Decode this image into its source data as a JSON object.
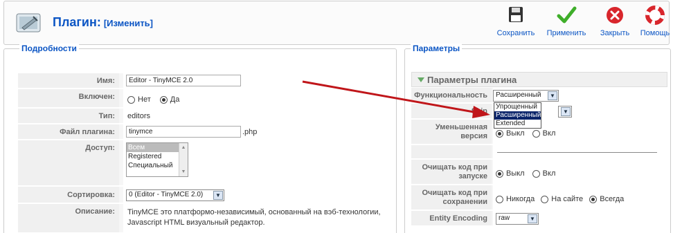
{
  "toolbar": {
    "title": "Плагин:",
    "subtitle": "[Изменить]",
    "save_label": "Сохранить",
    "apply_label": "Применить",
    "close_label": "Закрыть",
    "help_label": "Помощь"
  },
  "details": {
    "legend": "Подробности",
    "name_label": "Имя:",
    "name_value": "Editor - TinyMCE 2.0",
    "enabled_label": "Включен:",
    "enabled_no": "Нет",
    "enabled_yes": "Да",
    "type_label": "Тип:",
    "type_value": "editors",
    "file_label": "Файл плагина:",
    "file_value": "tinymce",
    "file_ext": ".php",
    "access_label": "Доступ:",
    "access_options": [
      "Всем",
      "Registered",
      "Специальный"
    ],
    "order_label": "Сортировка:",
    "order_value": "0 (Editor - TinyMCE 2.0)",
    "desc_label": "Описание:",
    "desc_line1": "TinyMCE это платформо-независимый, основанный на вэб-технологии,",
    "desc_line2": "Javascript HTML визуальный редактор."
  },
  "params": {
    "legend": "Параметры",
    "panel_title": "Параметры плагина",
    "func_label": "Функциональность",
    "func_value": "Расширенный",
    "func_options": [
      "Упрощенный",
      "Расширенный",
      "Extended"
    ],
    "skin_label": "Skin",
    "compressed_label1": "Уменьшенная",
    "compressed_label2": "версия",
    "off": "Выкл",
    "on": "Вкл",
    "cleanup_start_label1": "Очищать код при",
    "cleanup_start_label2": "запуске",
    "cleanup_save_label1": "Очищать код при",
    "cleanup_save_label2": "сохранении",
    "never": "Никогда",
    "front": "На сайте",
    "always": "Всегда",
    "encoding_label": "Entity Encoding",
    "encoding_value": "raw"
  },
  "colors": {
    "link_blue": "#0b55c4",
    "arrow_red": "#c0161a",
    "save_check_green": "#3fae2a",
    "close_red": "#d8262c"
  }
}
